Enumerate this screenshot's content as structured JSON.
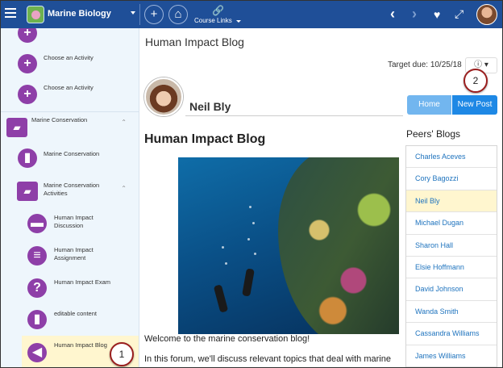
{
  "topbar": {
    "course_title": "Marine Biology",
    "add_symbol": "+",
    "home_symbol": "⌂",
    "course_links_label": "Course Links",
    "prev_symbol": "‹",
    "next_symbol": "›",
    "favorite_symbol": "♥",
    "expand_symbol": "⤢"
  },
  "sidebar": {
    "items": [
      {
        "label": "",
        "icon": "plus-icon",
        "symbol": "+"
      },
      {
        "label": "Choose an Activity",
        "icon": "plus-icon",
        "symbol": "+"
      },
      {
        "label": "Choose an Activity",
        "icon": "plus-icon",
        "symbol": "+"
      },
      {
        "label": "Marine Conservation",
        "icon": "folder-open-icon",
        "symbol": "▰",
        "expanded": true
      },
      {
        "label": "Marine Conservation",
        "icon": "page-icon",
        "symbol": "▮"
      },
      {
        "label": "Marine Conservation Activities",
        "icon": "folder-open-icon",
        "symbol": "▰",
        "expanded": true
      },
      {
        "label": "Human Impact Discussion",
        "icon": "discussion-icon",
        "symbol": "▬"
      },
      {
        "label": "Human Impact Assignment",
        "icon": "assignment-icon",
        "symbol": "≡"
      },
      {
        "label": "Human Impact Exam",
        "icon": "question-icon",
        "symbol": "?"
      },
      {
        "label": "editable content",
        "icon": "page-icon",
        "symbol": "▮"
      },
      {
        "label": "Human Impact Blog",
        "icon": "megaphone-icon",
        "symbol": "◀",
        "active": true
      }
    ],
    "collapse_symbol": "⌃"
  },
  "callouts": [
    "1",
    "2"
  ],
  "main": {
    "page_title": "Human Impact Blog",
    "target_due": "Target due: 10/25/18",
    "options_symbol": "ⓘ ▾",
    "author_name": "Neil Bly",
    "home_button": "Home",
    "new_post_button": "New Post",
    "blog_title": "Human Impact Blog",
    "welcome_text": "Welcome to the marine conservation blog!",
    "intro_text": "In this forum, we'll discuss relevant topics that deal with marine",
    "peers_title": "Peers' Blogs",
    "peers": [
      "Charles Aceves",
      "Cory Bagozzi",
      "Neil Bly",
      "Michael Dugan",
      "Sharon Hall",
      "Elsie Hoffmann",
      "David Johnson",
      "Wanda Smith",
      "Cassandra Williams",
      "James Williams"
    ],
    "active_peer": "Neil Bly"
  },
  "colors": {
    "topbar": "#1f4f98",
    "sidebar_bg": "#eef6fc",
    "activity_icon": "#8e3fa8",
    "highlight": "#fff6cf",
    "link": "#1e73be",
    "primary_button": "#1e88e5",
    "secondary_button": "#72b6ef",
    "callout_border": "#9a1e1e"
  }
}
